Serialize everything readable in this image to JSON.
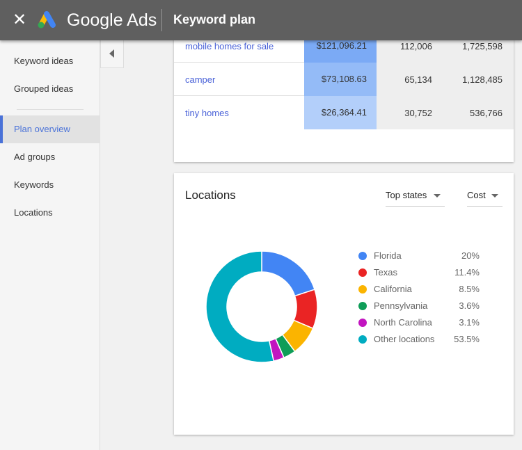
{
  "header": {
    "brand": "Google Ads",
    "title": "Keyword plan",
    "close_icon": "close-icon"
  },
  "sidebar": {
    "items": [
      {
        "label": "Keyword ideas"
      },
      {
        "label": "Grouped ideas"
      },
      {
        "label": "Plan overview",
        "active": true
      },
      {
        "label": "Ad groups"
      },
      {
        "label": "Keywords"
      },
      {
        "label": "Locations"
      }
    ]
  },
  "keywords_table": {
    "rows": [
      {
        "keyword": "mobile homes for sale",
        "cost": "$121,096.21",
        "col3": "112,006",
        "col4": "1,725,598",
        "shade": "#7baaf5"
      },
      {
        "keyword": "camper",
        "cost": "$73,108.63",
        "col3": "65,134",
        "col4": "1,128,485",
        "shade": "#94bbf7"
      },
      {
        "keyword": "tiny homes",
        "cost": "$26,364.41",
        "col3": "30,752",
        "col4": "536,766",
        "shade": "#b3cffa"
      }
    ]
  },
  "locations": {
    "title": "Locations",
    "filter1": "Top states",
    "filter2": "Cost"
  },
  "chart_data": {
    "type": "pie",
    "donut": true,
    "categories": [
      "Florida",
      "Texas",
      "California",
      "Pennsylvania",
      "North Carolina",
      "Other locations"
    ],
    "values": [
      20,
      11.4,
      8.5,
      3.6,
      3.1,
      53.5
    ],
    "labels": [
      "20%",
      "11.4%",
      "8.5%",
      "3.6%",
      "3.1%",
      "53.5%"
    ],
    "colors": [
      "#4285f4",
      "#ea2424",
      "#fbb400",
      "#0f9d58",
      "#c215c0",
      "#00acc1"
    ],
    "legend": "right"
  }
}
